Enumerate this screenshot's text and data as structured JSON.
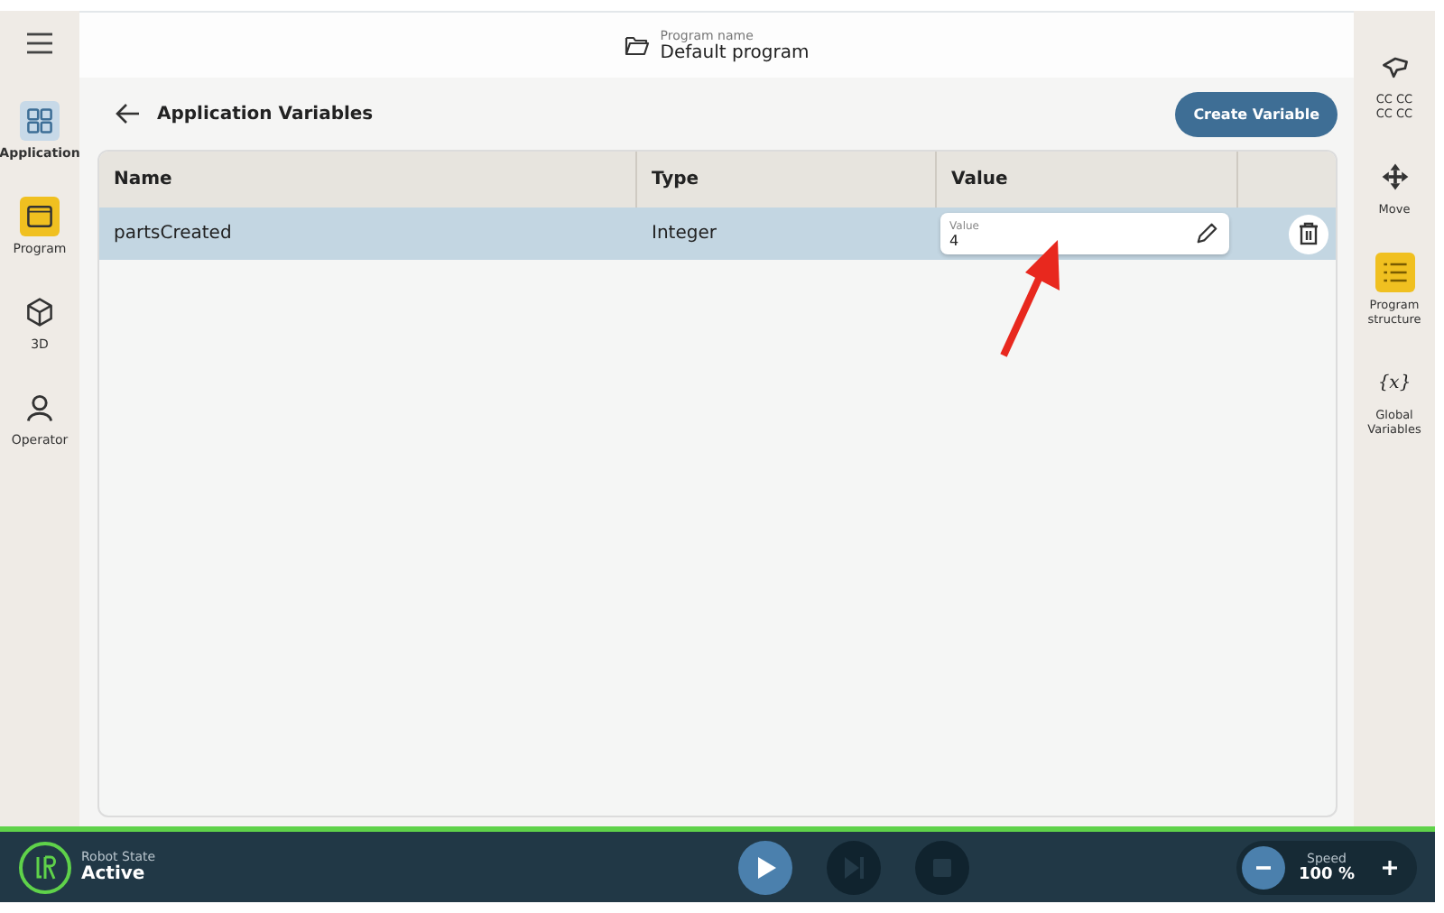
{
  "header": {
    "label": "Program name",
    "title": "Default program"
  },
  "left_nav": [
    {
      "label": "Application",
      "kind": "grid",
      "selected": true,
      "accent": false
    },
    {
      "label": "Program",
      "kind": "window",
      "selected": false,
      "accent": true
    },
    {
      "label": "3D",
      "kind": "cube",
      "selected": false,
      "accent": false
    },
    {
      "label": "Operator",
      "kind": "person",
      "selected": false,
      "accent": false
    }
  ],
  "right_nav": [
    {
      "label": "CC CC\nCC CC",
      "kind": "hand",
      "accent": false
    },
    {
      "label": "Move",
      "kind": "move",
      "accent": false
    },
    {
      "label": "Program\nstructure",
      "kind": "list",
      "accent": true
    },
    {
      "label": "Global\nVariables",
      "glyph": "{x}",
      "accent": false
    }
  ],
  "page": {
    "title": "Application Variables",
    "create_button": "Create Variable"
  },
  "table": {
    "columns": [
      "Name",
      "Type",
      "Value"
    ],
    "rows": [
      {
        "name": "partsCreated",
        "type": "Integer",
        "value_label": "Value",
        "value": "4",
        "selected": true
      }
    ]
  },
  "status_bar": {
    "label": "Robot State",
    "state": "Active",
    "controls": [
      {
        "kind": "play",
        "disabled": false
      },
      {
        "kind": "step",
        "disabled": true
      },
      {
        "kind": "stop",
        "disabled": true
      }
    ],
    "speed_label": "Speed",
    "speed": "100 %"
  }
}
